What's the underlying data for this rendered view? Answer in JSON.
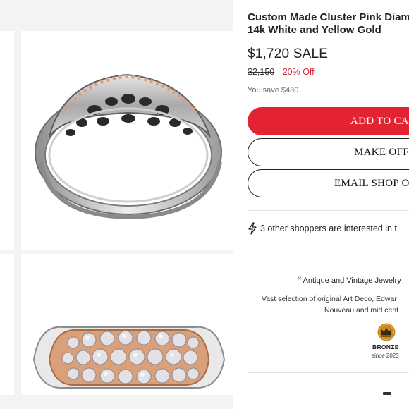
{
  "product": {
    "title_line1": "Custom Made Cluster Pink Diam",
    "title_line2": "14k White and Yellow Gold",
    "sale_price": "$1,720 SALE",
    "original_price": "$2,150",
    "discount": "20% Off",
    "savings": "You save $430"
  },
  "actions": {
    "add_to_cart": "ADD TO CA",
    "make_offer": "MAKE OFF",
    "email_shop": "EMAIL SHOP O"
  },
  "interest": {
    "icon": "lightning-icon",
    "text": "3 other shoppers are interested in t"
  },
  "shop": {
    "name_prefix": "“",
    "name": "Antique and Vintage Jewelry",
    "description_line1": "Vast selection of original Art Deco, Edwar",
    "description_line2": "Nouveau and mid cent",
    "badge_icon": "crown-icon",
    "badge_label": "BRONZE",
    "badge_since": "since 2023",
    "badge_color": "#c9871f"
  },
  "colors": {
    "accent": "#e32232",
    "discount": "#d2283a"
  }
}
